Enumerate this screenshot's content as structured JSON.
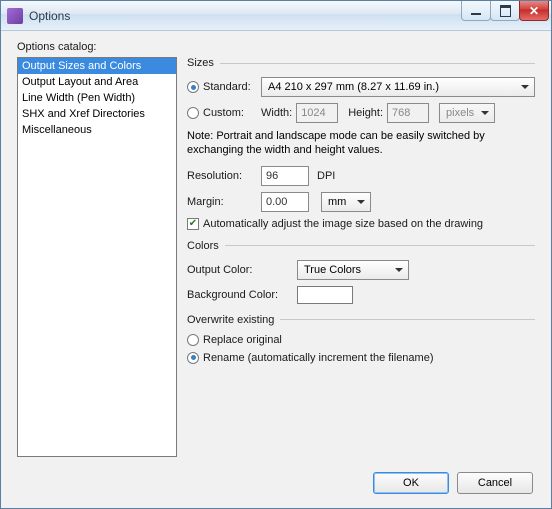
{
  "window": {
    "title": "Options"
  },
  "catalog": {
    "label": "Options catalog:",
    "items": [
      "Output Sizes and Colors",
      "Output Layout and Area",
      "Line Width (Pen Width)",
      "SHX and Xref Directories",
      "Miscellaneous"
    ],
    "selected": 0
  },
  "sizes": {
    "title": "Sizes",
    "standard_label": "Standard:",
    "standard_value": "A4 210 x 297 mm (8.27 x 11.69 in.)",
    "custom_label": "Custom:",
    "width_label": "Width:",
    "width_value": "1024",
    "height_label": "Height:",
    "height_value": "768",
    "units": "pixels",
    "note": "Note: Portrait and landscape mode can be easily switched by exchanging the width and height values.",
    "resolution_label": "Resolution:",
    "resolution_value": "96",
    "resolution_unit": "DPI",
    "margin_label": "Margin:",
    "margin_value": "0.00",
    "margin_unit": "mm",
    "auto_adjust": "Automatically adjust the image size based on the drawing"
  },
  "colors": {
    "title": "Colors",
    "output_label": "Output Color:",
    "output_value": "True Colors",
    "bg_label": "Background Color:",
    "bg_value": "#ffffff"
  },
  "overwrite": {
    "title": "Overwrite existing",
    "replace": "Replace original",
    "rename": "Rename (automatically increment the filename)"
  },
  "buttons": {
    "ok": "OK",
    "cancel": "Cancel"
  }
}
